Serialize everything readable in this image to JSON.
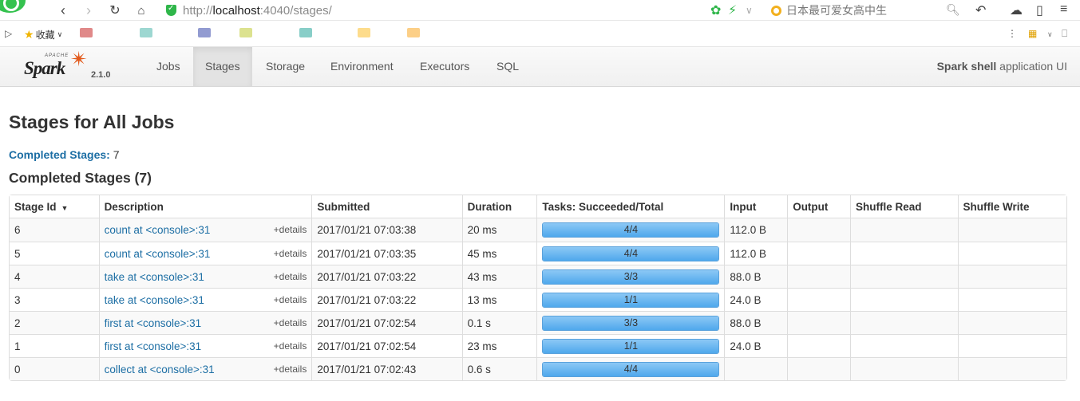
{
  "browser": {
    "url_scheme": "http://",
    "url_host": "localhost",
    "url_rest": ":4040/stages/",
    "search_placeholder": "日本最可爱女高中生",
    "bookmark_fav_label": "收藏"
  },
  "nav": {
    "version": "2.1.0",
    "apache_label": "APACHE",
    "brand_label": "Spark",
    "tabs": [
      "Jobs",
      "Stages",
      "Storage",
      "Environment",
      "Executors",
      "SQL"
    ],
    "active_tab": "Stages",
    "app_name": "Spark shell",
    "app_suffix": " application UI"
  },
  "page": {
    "title": "Stages for All Jobs",
    "summary_link": "Completed Stages:",
    "summary_count": " 7",
    "section_title": "Completed Stages (7)"
  },
  "table": {
    "headers": [
      "Stage Id",
      "Description",
      "Submitted",
      "Duration",
      "Tasks: Succeeded/Total",
      "Input",
      "Output",
      "Shuffle Read",
      "Shuffle Write"
    ],
    "details_label": "+details",
    "rows": [
      {
        "id": "6",
        "description": "count at <console>:31",
        "submitted": "2017/01/21 07:03:38",
        "duration": "20 ms",
        "tasks": "4/4",
        "progress": 1.0,
        "input": "112.0 B",
        "output": "",
        "shuffle_read": "",
        "shuffle_write": ""
      },
      {
        "id": "5",
        "description": "count at <console>:31",
        "submitted": "2017/01/21 07:03:35",
        "duration": "45 ms",
        "tasks": "4/4",
        "progress": 1.0,
        "input": "112.0 B",
        "output": "",
        "shuffle_read": "",
        "shuffle_write": ""
      },
      {
        "id": "4",
        "description": "take at <console>:31",
        "submitted": "2017/01/21 07:03:22",
        "duration": "43 ms",
        "tasks": "3/3",
        "progress": 1.0,
        "input": "88.0 B",
        "output": "",
        "shuffle_read": "",
        "shuffle_write": ""
      },
      {
        "id": "3",
        "description": "take at <console>:31",
        "submitted": "2017/01/21 07:03:22",
        "duration": "13 ms",
        "tasks": "1/1",
        "progress": 1.0,
        "input": "24.0 B",
        "output": "",
        "shuffle_read": "",
        "shuffle_write": ""
      },
      {
        "id": "2",
        "description": "first at <console>:31",
        "submitted": "2017/01/21 07:02:54",
        "duration": "0.1 s",
        "tasks": "3/3",
        "progress": 1.0,
        "input": "88.0 B",
        "output": "",
        "shuffle_read": "",
        "shuffle_write": ""
      },
      {
        "id": "1",
        "description": "first at <console>:31",
        "submitted": "2017/01/21 07:02:54",
        "duration": "23 ms",
        "tasks": "1/1",
        "progress": 1.0,
        "input": "24.0 B",
        "output": "",
        "shuffle_read": "",
        "shuffle_write": ""
      },
      {
        "id": "0",
        "description": "collect at <console>:31",
        "submitted": "2017/01/21 07:02:43",
        "duration": "0.6 s",
        "tasks": "4/4",
        "progress": 1.0,
        "input": "",
        "output": "",
        "shuffle_read": "",
        "shuffle_write": ""
      }
    ]
  },
  "colors": {
    "link": "#1c6ea4",
    "progress_fill": "#4fa8ec",
    "spark_orange": "#e25a1c"
  }
}
